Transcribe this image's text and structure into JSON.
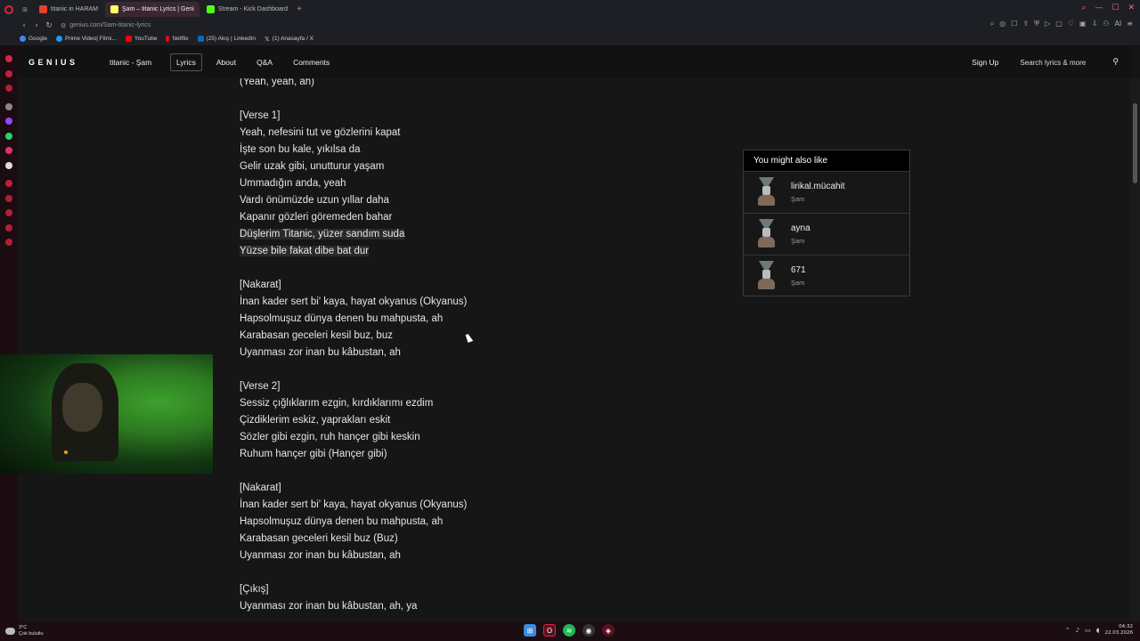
{
  "browser": {
    "tabs": [
      {
        "label": "titanic in HARAM",
        "color": "#e3432b"
      },
      {
        "label": "Şam – titanic Lyrics | Geni",
        "color": "#ffff64"
      },
      {
        "label": "Stream - Kick Dashboard",
        "color": "#53fc18"
      }
    ],
    "url": "genius.com/Sam-titanic-lyrics",
    "bookmarks": [
      {
        "label": "Google",
        "color": "#4285f4"
      },
      {
        "label": "Prime Video| Filmi...",
        "color": "#1a98ff"
      },
      {
        "label": "YouTube",
        "color": "#ff0000"
      },
      {
        "label": "Netflix",
        "color": "#e50914"
      },
      {
        "label": "(25) Akış | LinkedIn",
        "color": "#0a66c2"
      },
      {
        "label": "(1) Anasayfa / X",
        "color": "#000000"
      }
    ],
    "ai_label": "AI"
  },
  "genius": {
    "logo": "GENIUS",
    "song_title": "titanic - Şam",
    "nav": [
      "Lyrics",
      "About",
      "Q&A",
      "Comments"
    ],
    "sign_up": "Sign Up",
    "search_placeholder": "Search lyrics & more"
  },
  "lyrics": [
    {
      "text": "(Yeah, yeah, ah)"
    },
    {
      "gap": true
    },
    {
      "text": "[Verse 1]"
    },
    {
      "text": "Yeah, nefesini tut ve gözlerini kapat"
    },
    {
      "text": "İşte son bu kale, yıkılsa da"
    },
    {
      "text": "Gelir uzak gibi, unutturur yaşam"
    },
    {
      "text": "Ummadığın anda, yeah"
    },
    {
      "text": "Vardı önümüzde uzun yıllar daha"
    },
    {
      "text": "Kapanır gözleri göremeden bahar"
    },
    {
      "text": "Düşlerim Titanic, yüzer sandım suda",
      "hl": true
    },
    {
      "text": "Yüzse bile fakat dibe bat dur",
      "hl": true
    },
    {
      "gap": true
    },
    {
      "text": "[Nakarat]"
    },
    {
      "text": "İnan kader sert bi' kaya, hayat okyanus (Okyanus)"
    },
    {
      "text": "Hapsolmuşuz dünya denen bu mahpusta, ah"
    },
    {
      "text": "Karabasan geceleri kesil buz, buz"
    },
    {
      "text": "Uyanması zor inan bu kâbustan, ah"
    },
    {
      "gap": true
    },
    {
      "text": "[Verse 2]"
    },
    {
      "text": "Sessiz çığlıklarım ezgin, kırdıklarımı ezdim"
    },
    {
      "text": "Çizdiklerim eskiz, yaprakları eskit"
    },
    {
      "text": "Sözler gibi ezgin, ruh hançer gibi keskin"
    },
    {
      "text": "Ruhum hançer gibi (Hançer gibi)"
    },
    {
      "gap": true
    },
    {
      "text": "[Nakarat]"
    },
    {
      "text": "İnan kader sert bi' kaya, hayat okyanus (Okyanus)"
    },
    {
      "text": "Hapsolmuşuz dünya denen bu mahpusta, ah"
    },
    {
      "text": "Karabasan geceleri kesil buz (Buz)"
    },
    {
      "text": "Uyanması zor inan bu kâbustan, ah"
    },
    {
      "gap": true
    },
    {
      "text": "[Çıkış]"
    },
    {
      "text": "Uyanması zor inan bu kâbustan, ah, ya"
    }
  ],
  "recommendations": {
    "heading": "You might also like",
    "items": [
      {
        "title": "lirikal.mücahit",
        "artist": "Şam"
      },
      {
        "title": "ayna",
        "artist": "Şam"
      },
      {
        "title": "671",
        "artist": "Şam"
      }
    ]
  },
  "taskbar": {
    "temperature": "3°C",
    "weather": "Çok bulutlu",
    "time": "04:32",
    "date": "22.03.2026"
  }
}
